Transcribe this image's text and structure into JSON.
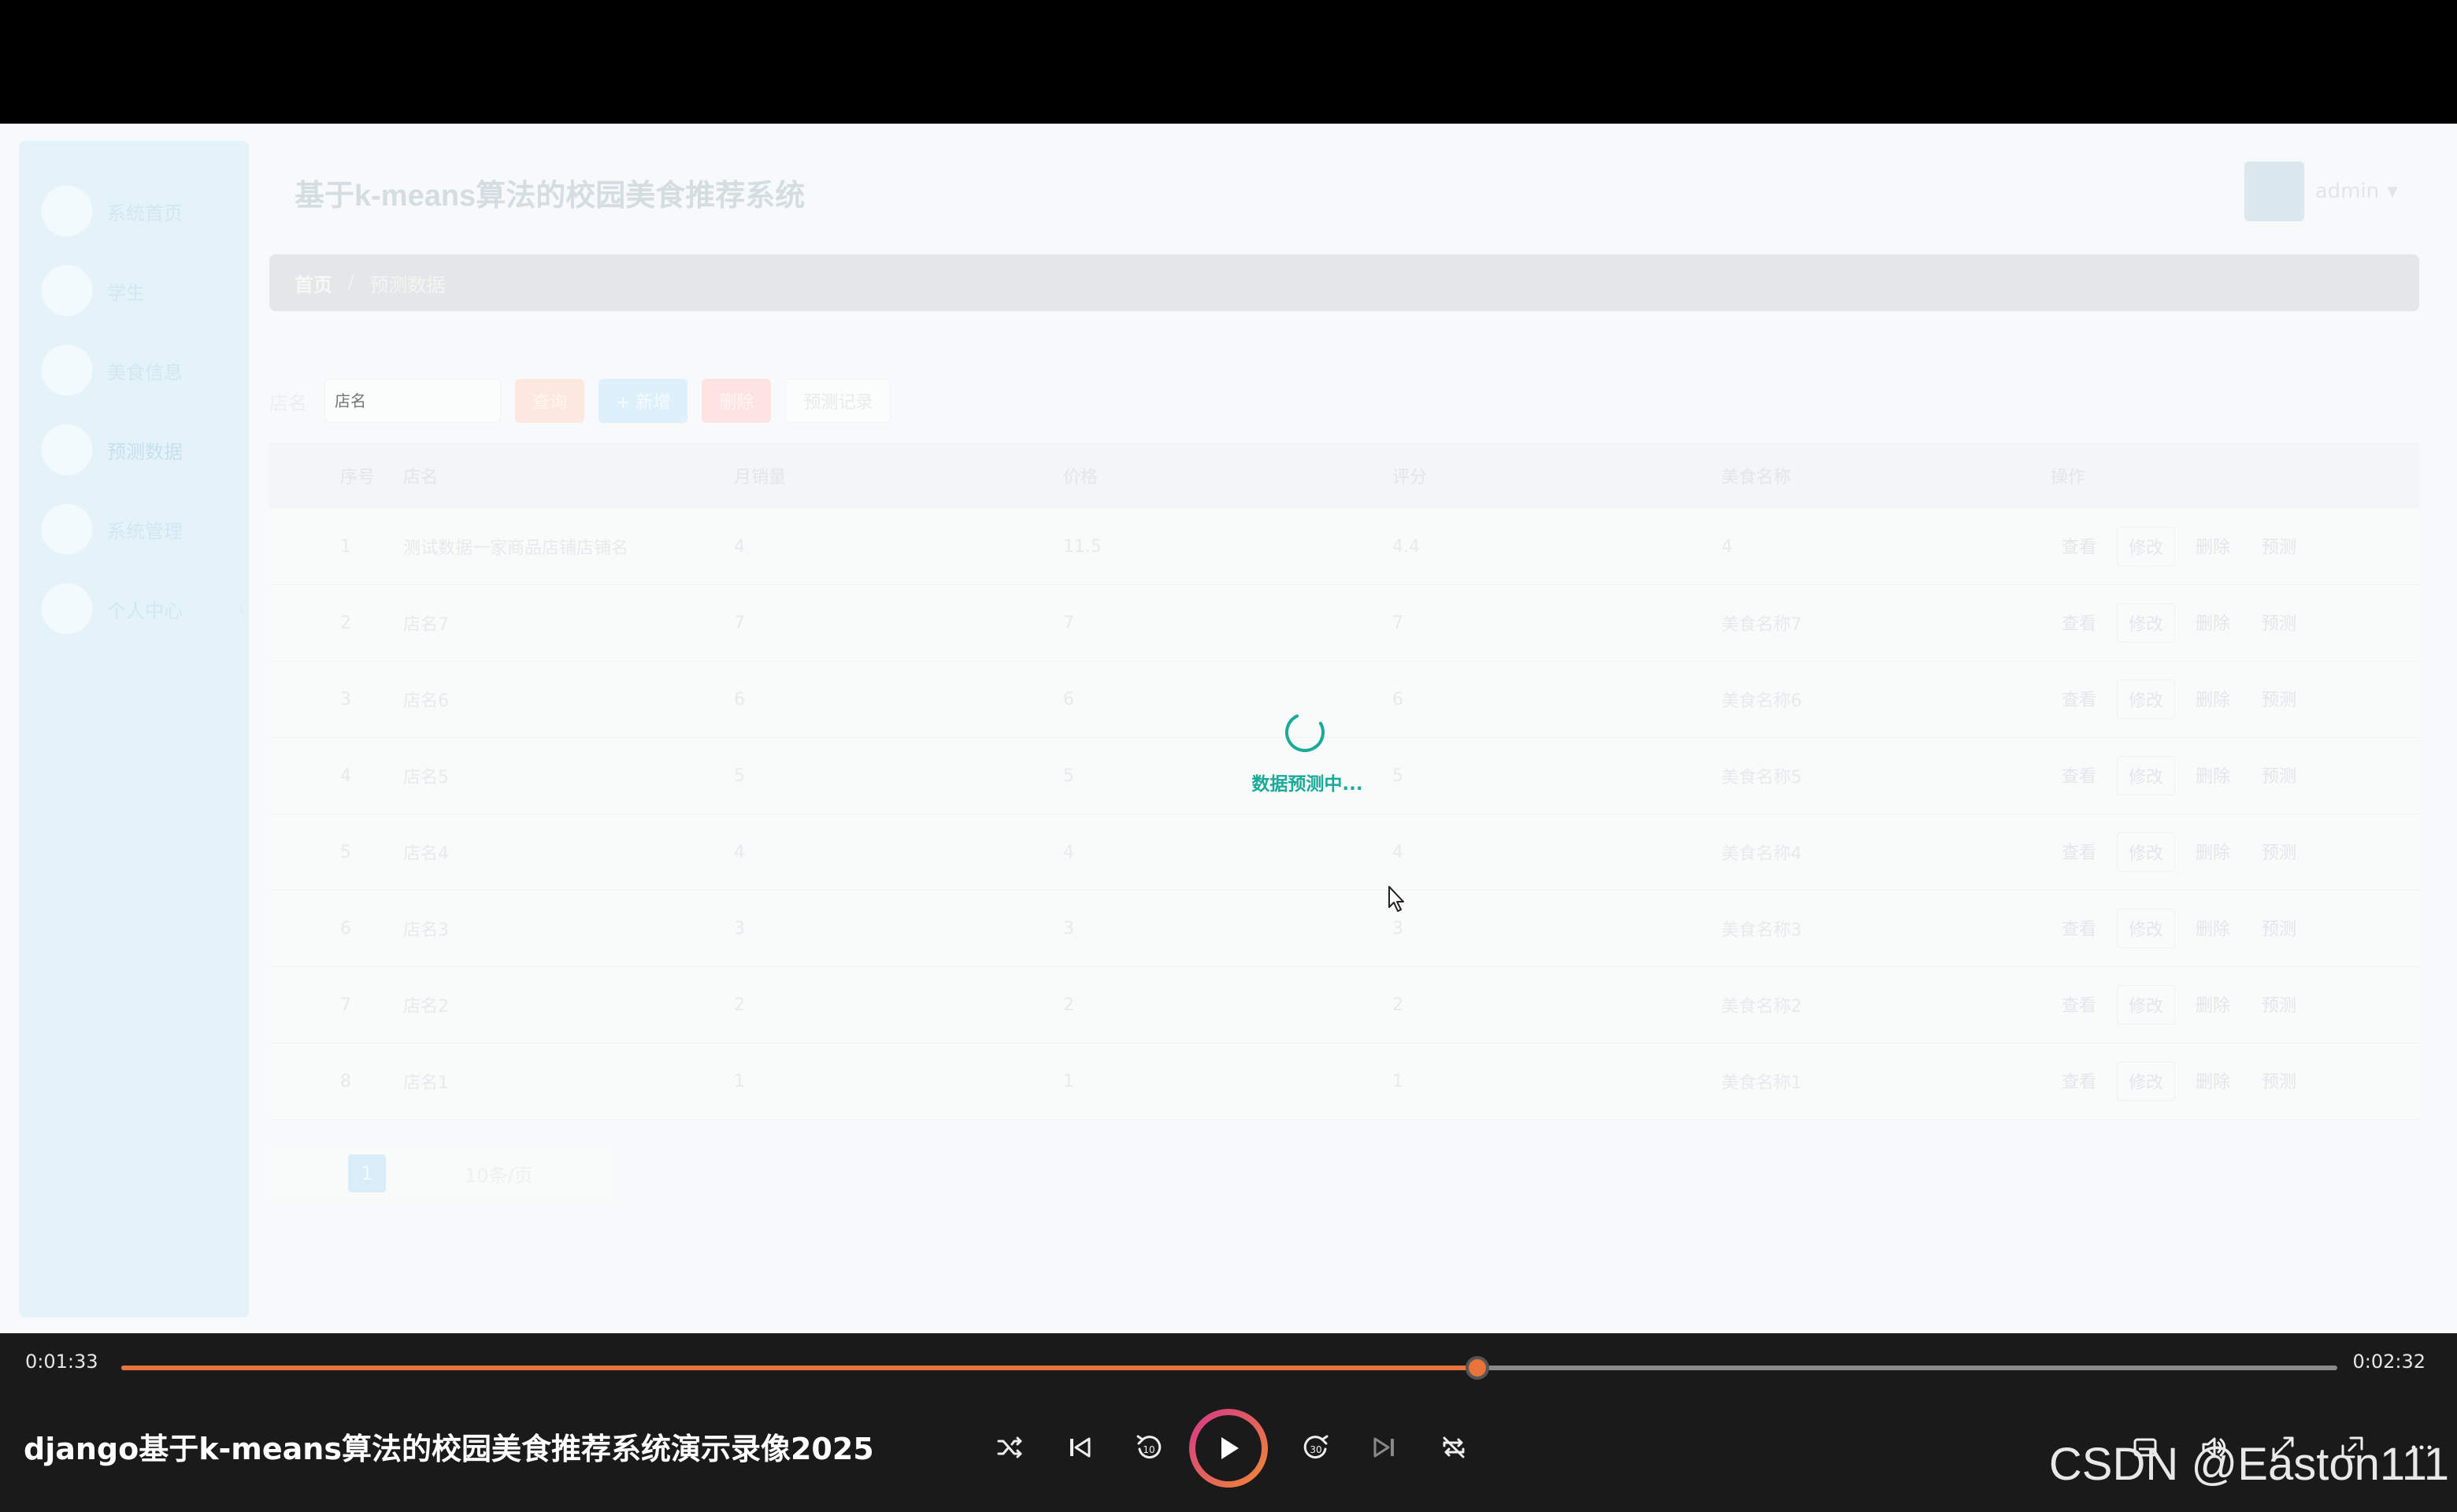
{
  "app": {
    "title": "基于k-means算法的校园美食推荐系统",
    "user": {
      "name": "admin"
    }
  },
  "sidebar": {
    "items": [
      {
        "label": "系统首页"
      },
      {
        "label": "学生"
      },
      {
        "label": "美食信息"
      },
      {
        "label": "预测数据"
      },
      {
        "label": "系统管理"
      },
      {
        "label": "个人中心"
      }
    ]
  },
  "breadcrumb": {
    "home": "首页",
    "separator": "/",
    "current": "预测数据"
  },
  "toolbar": {
    "filter_label": "店名",
    "filter_placeholder": "店名",
    "query_label": "查询",
    "add_label": "+ 新增",
    "delete_label": "删除",
    "predict_label": "预测记录"
  },
  "table": {
    "headers": [
      "序号",
      "店名",
      "月销量",
      "价格",
      "评分",
      "美食名称",
      "操作"
    ],
    "rows": [
      {
        "no": "1",
        "shop": "测试数据一家商品店铺店铺名",
        "sales": "4",
        "price": "11.5",
        "score": "4.4",
        "food": "4"
      },
      {
        "no": "2",
        "shop": "店名7",
        "sales": "7",
        "price": "7",
        "score": "7",
        "food": "美食名称7"
      },
      {
        "no": "3",
        "shop": "店名6",
        "sales": "6",
        "price": "6",
        "score": "6",
        "food": "美食名称6"
      },
      {
        "no": "4",
        "shop": "店名5",
        "sales": "5",
        "price": "5",
        "score": "5",
        "food": "美食名称5"
      },
      {
        "no": "5",
        "shop": "店名4",
        "sales": "4",
        "price": "4",
        "score": "4",
        "food": "美食名称4"
      },
      {
        "no": "6",
        "shop": "店名3",
        "sales": "3",
        "price": "3",
        "score": "3",
        "food": "美食名称3"
      },
      {
        "no": "7",
        "shop": "店名2",
        "sales": "2",
        "price": "2",
        "score": "2",
        "food": "美食名称2"
      },
      {
        "no": "8",
        "shop": "店名1",
        "sales": "1",
        "price": "1",
        "score": "1",
        "food": "美食名称1"
      }
    ],
    "actions": [
      "查看",
      "修改",
      "删除",
      "预测"
    ]
  },
  "pagination": {
    "current_page": "1",
    "page_size": "10条/页"
  },
  "loading": {
    "text": "数据预测中..."
  },
  "player": {
    "current_time": "0:01:33",
    "total_time": "0:02:32",
    "progress": 0.612,
    "title": "django基于k-means算法的校园美食推荐系统演示录像2025",
    "accent_color": "#e8743b"
  },
  "watermark": "CSDN @Easton111"
}
